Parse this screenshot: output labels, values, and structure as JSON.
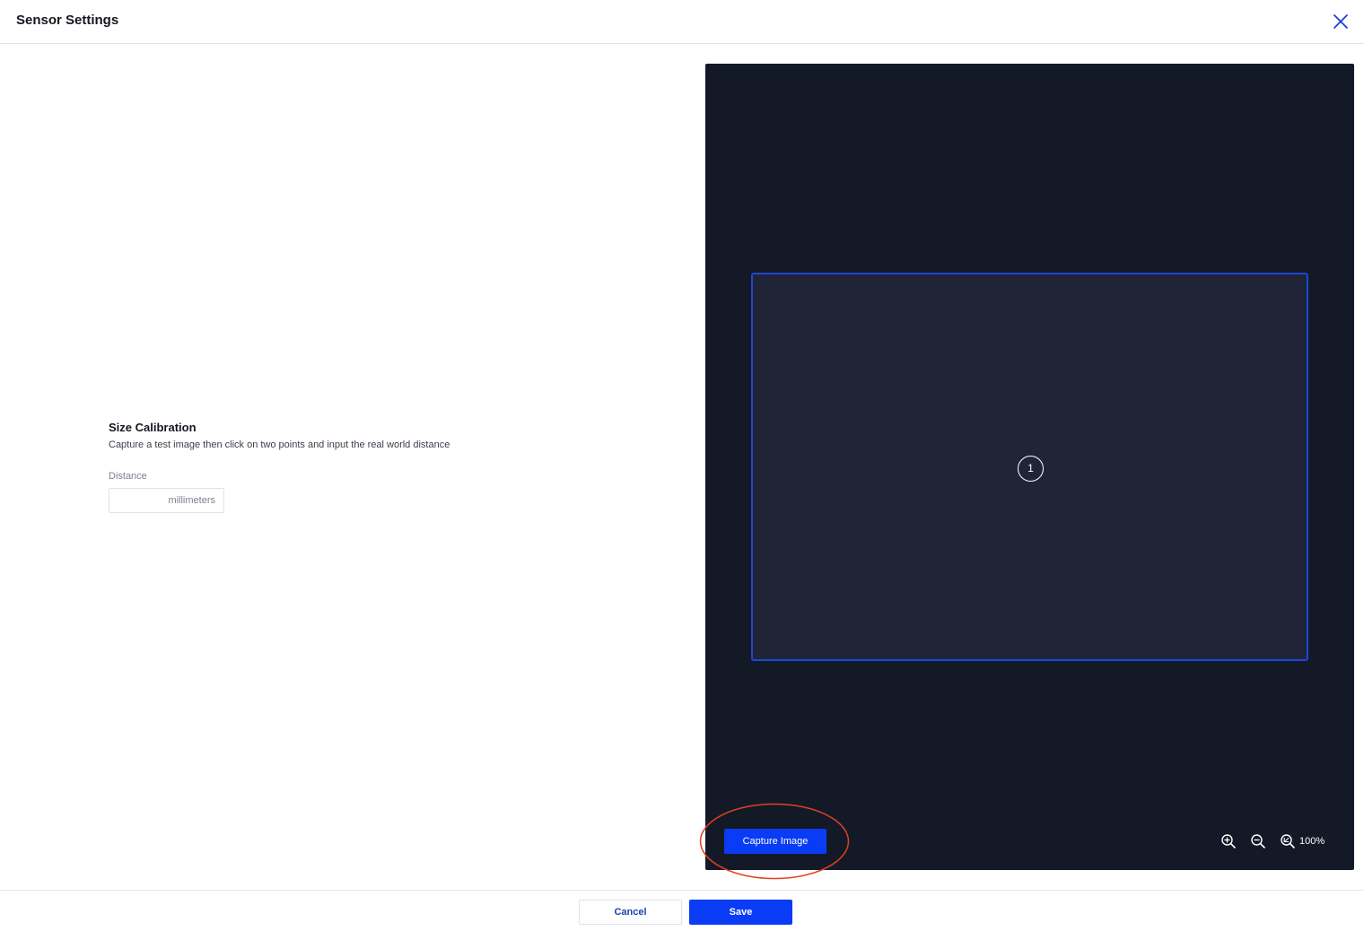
{
  "header": {
    "title": "Sensor Settings",
    "close_icon": "close-icon"
  },
  "calibration": {
    "title": "Size Calibration",
    "description": "Capture a test image then click on two points and input the real world distance",
    "distance_label": "Distance",
    "distance_value": "",
    "distance_unit": "millimeters"
  },
  "viewer": {
    "marker_label": "1",
    "capture_label": "Capture Image",
    "zoom_in_icon": "zoom-in-icon",
    "zoom_out_icon": "zoom-out-icon",
    "zoom_reset_icon": "zoom-reset-icon",
    "zoom_level": "100%"
  },
  "footer": {
    "cancel_label": "Cancel",
    "save_label": "Save"
  },
  "colors": {
    "accent": "#0a3bf5",
    "viewer_bg": "#131927",
    "roi_bg": "#1f2536",
    "roi_border": "#1d46d6",
    "annotation": "#e0401f"
  }
}
